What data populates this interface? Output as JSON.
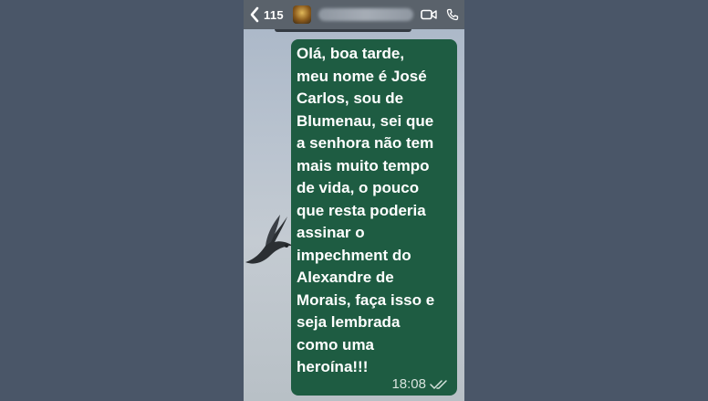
{
  "header": {
    "back_count": "115",
    "contact_name": "",
    "icons": [
      "chevron-left-icon",
      "avatar",
      "video-call-icon",
      "phone-call-icon"
    ]
  },
  "message": {
    "text": "Olá, boa tarde,\nmeu nome é José\nCarlos, sou de\nBlumenau, sei que\na senhora não tem\nmais muito tempo\nde vida, o pouco\nque resta poderia\nassinar o\nimpechment do\nAlexandre de\nMorais, faça isso e\nseja lembrada\ncomo uma\nheroína!!!",
    "time": "18:08",
    "status_icon": "double-check-icon"
  },
  "colors": {
    "page_background": "#4a5668",
    "header_background": "#5a626b",
    "bubble_background": "#1e5c42",
    "bubble_text": "#ffffff"
  }
}
